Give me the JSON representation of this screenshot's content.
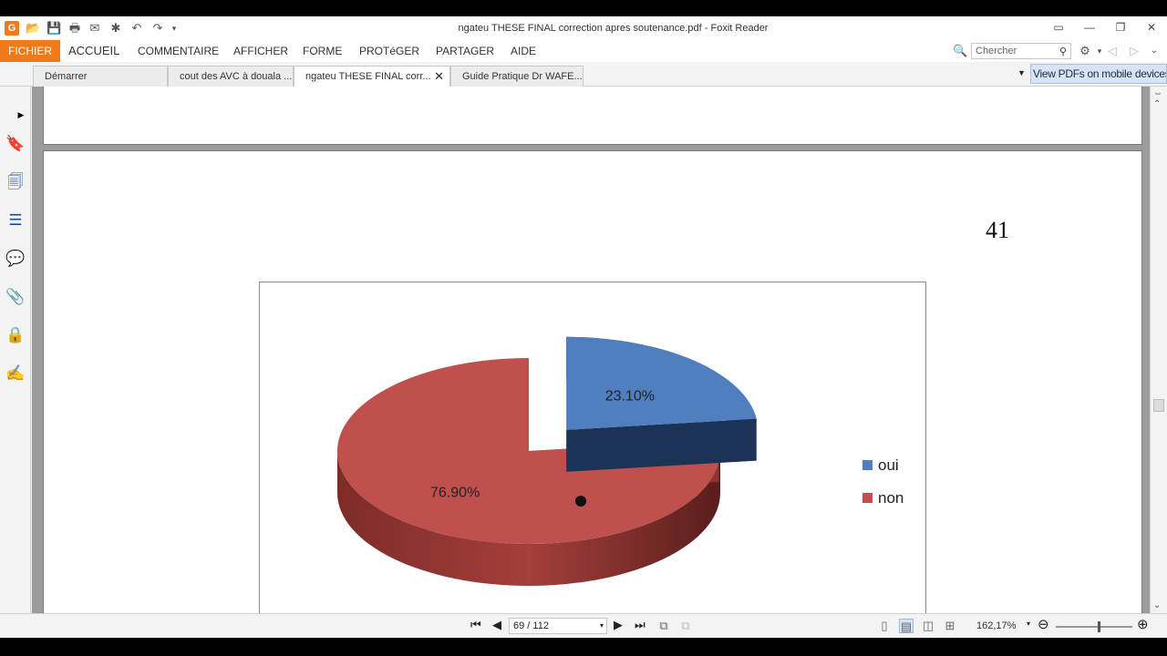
{
  "window": {
    "title": "ngateu THESE FINAL correction apres soutenance.pdf - Foxit Reader",
    "logo": "G",
    "controls": [
      "▭",
      "—",
      "❐",
      "✕"
    ]
  },
  "menu": {
    "items": [
      "FICHIER",
      "ACCUEIL",
      "COMMENTAIRE",
      "AFFICHER",
      "FORME",
      "PROTéGER",
      "PARTAGER",
      "AIDE"
    ],
    "search_placeholder": "Chercher"
  },
  "tabs": {
    "items": [
      {
        "label": "Démarrer"
      },
      {
        "label": "cout des AVC à douala ..."
      },
      {
        "label": "ngateu THESE FINAL corr..."
      },
      {
        "label": "Guide Pratique Dr WAFE..."
      }
    ],
    "active_index": 2,
    "banner": "View PDFs on mobile devices"
  },
  "document": {
    "page_number_label": "41"
  },
  "chart_data": {
    "type": "pie",
    "categories": [
      "oui",
      "non"
    ],
    "values": [
      23.1,
      76.9
    ],
    "data_labels": [
      "23.10%",
      "76.90%"
    ],
    "colors": {
      "oui": "#4f7fbf",
      "non": "#c0504d"
    },
    "legend": {
      "position": "right",
      "entries": [
        "oui",
        "non"
      ]
    },
    "style": "3d-exploded"
  },
  "statusbar": {
    "page_field": "69 / 112",
    "zoom": "162,17%"
  }
}
